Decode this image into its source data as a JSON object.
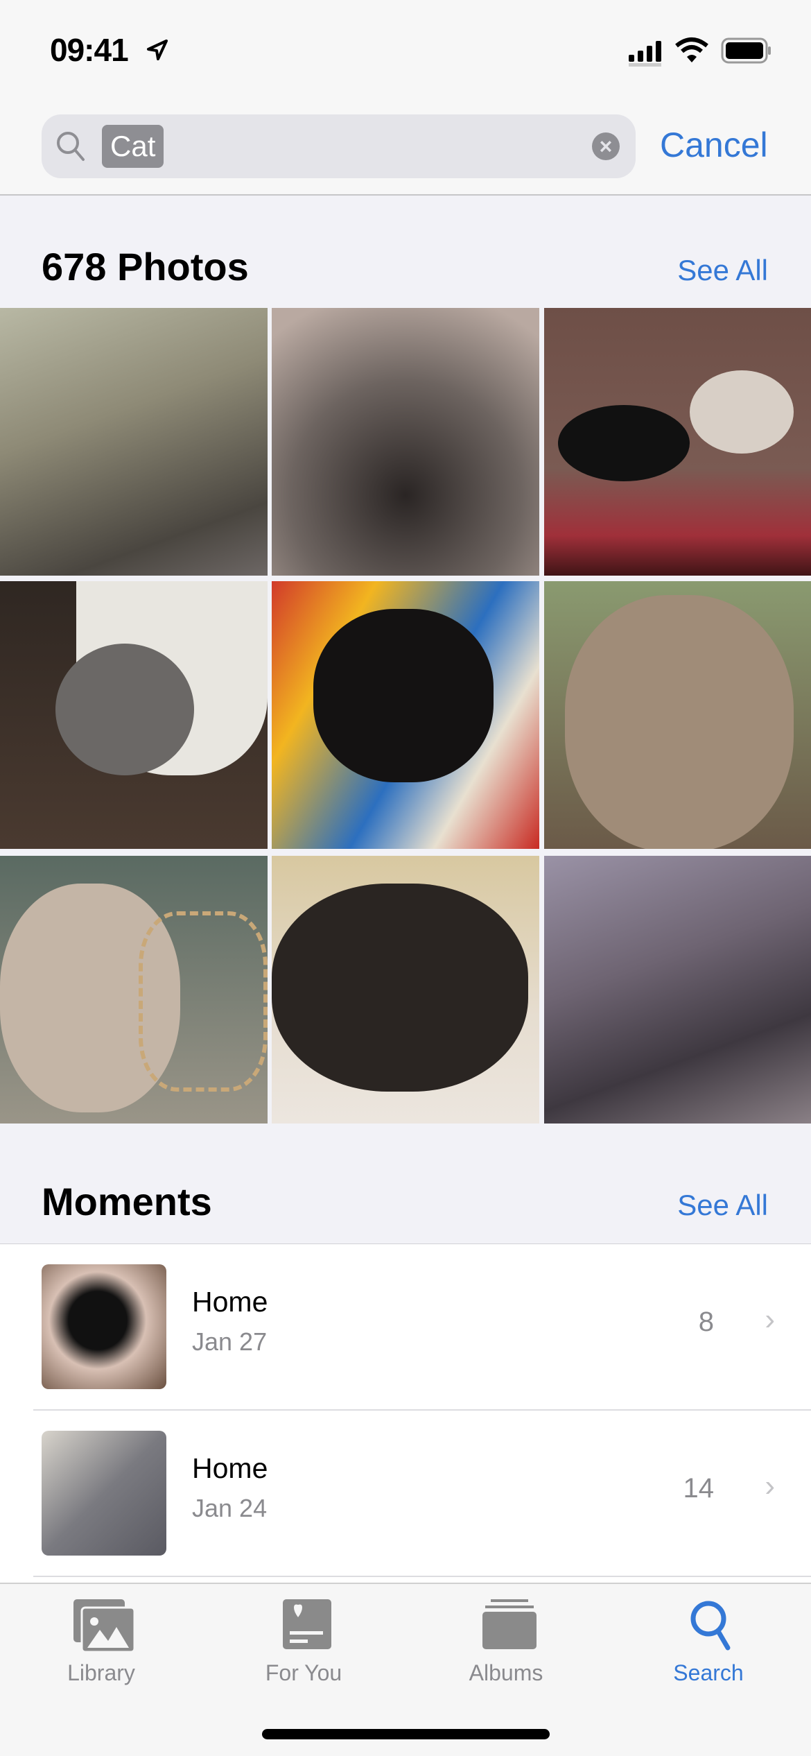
{
  "status": {
    "time": "09:41"
  },
  "search": {
    "token": "Cat",
    "cancel": "Cancel"
  },
  "photos": {
    "title": "678 Photos",
    "see_all": "See All",
    "items": [
      "blurred photo",
      "blurred photo",
      "black and siamese cats on blanket",
      "gray cat in bed",
      "black cat in striped blanket",
      "tabby cat looking up",
      "siamese cat with rope",
      "black cat on bedding",
      "blurred photo"
    ]
  },
  "moments": {
    "title": "Moments",
    "see_all": "See All",
    "rows": [
      {
        "title": "Home",
        "date": "Jan 27",
        "count": "8"
      },
      {
        "title": "Home",
        "date": "Jan 24",
        "count": "14"
      }
    ]
  },
  "tabs": [
    {
      "label": "Library",
      "icon": "photo-stack-icon"
    },
    {
      "label": "For You",
      "icon": "heart-card-icon"
    },
    {
      "label": "Albums",
      "icon": "albums-icon"
    },
    {
      "label": "Search",
      "icon": "search-icon",
      "active": true
    }
  ],
  "colors": {
    "accent": "#3478d6",
    "inactive": "#8a8a8e"
  }
}
